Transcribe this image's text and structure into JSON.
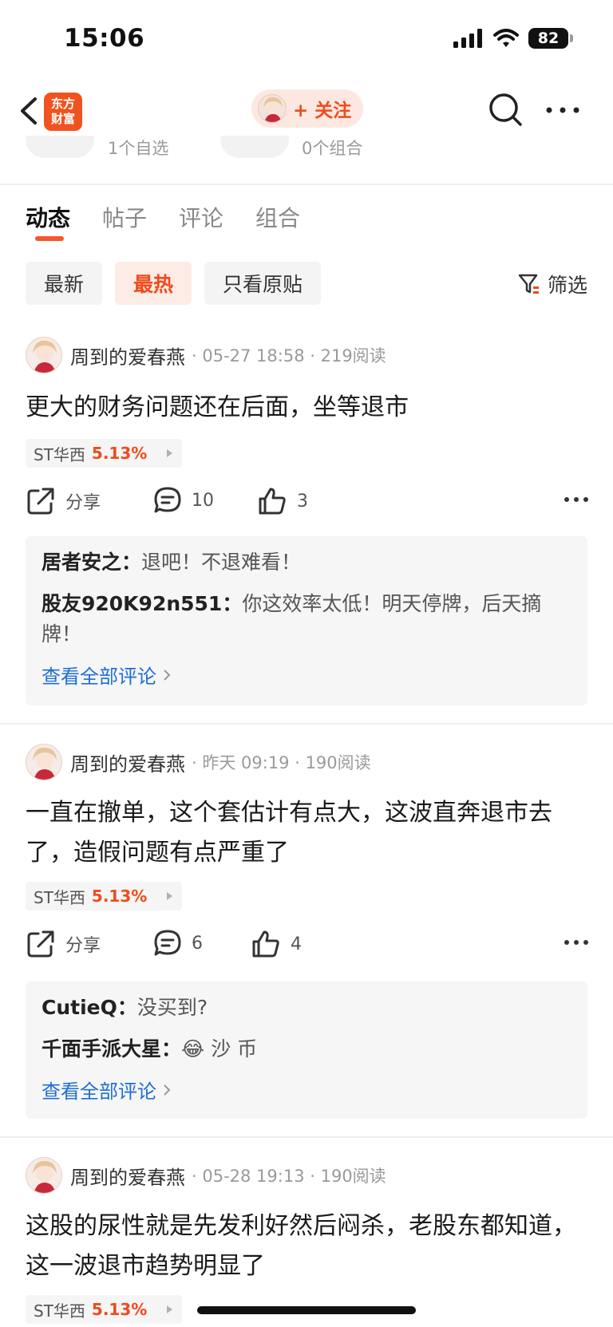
{
  "status_bar": {
    "time": "15:06",
    "battery": "82"
  },
  "nav": {
    "logo_text_line1": "东方",
    "logo_text_line2": "财富",
    "follow_label": "+ 关注"
  },
  "peek": {
    "left_text": "1个自选",
    "right_text": "0个组合"
  },
  "tabs": [
    {
      "label": "动态",
      "active": true
    },
    {
      "label": "帖子"
    },
    {
      "label": "评论"
    },
    {
      "label": "组合"
    }
  ],
  "chips": [
    {
      "label": "最新"
    },
    {
      "label": "最热",
      "active": true
    },
    {
      "label": "只看原贴"
    }
  ],
  "filter_label": "筛选",
  "posts": [
    {
      "author": "周到的爱春燕",
      "meta": "· 05-27 18:58 · 219阅读",
      "content": "更大的财务问题还在后面，坐等退市",
      "stock_name": "ST华西",
      "stock_change": "5.13%",
      "share_label": "分享",
      "comment_count": "10",
      "like_count": "3",
      "comments": [
        {
          "user": "居者安之：",
          "text": "退吧！不退难看！"
        },
        {
          "user": "股友920K92n551：",
          "text": "你这效率太低！明天停牌，后天摘牌！"
        }
      ],
      "view_all": "查看全部评论"
    },
    {
      "author": "周到的爱春燕",
      "meta": "· 昨天 09:19 · 190阅读",
      "content": "一直在撤单，这个套估计有点大，这波直奔退市去了，造假问题有点严重了",
      "stock_name": "ST华西",
      "stock_change": "5.13%",
      "share_label": "分享",
      "comment_count": "6",
      "like_count": "4",
      "comments": [
        {
          "user": "CutieQ：",
          "text": "没买到?"
        },
        {
          "user": "千面手派大星：",
          "text": "沙 币",
          "emoji": "😂"
        }
      ],
      "view_all": "查看全部评论"
    },
    {
      "author": "周到的爱春燕",
      "meta": "· 05-28 19:13 · 190阅读",
      "content": "这股的尿性就是先发利好然后闷杀，老股东都知道，这一波退市趋势明显了",
      "stock_name": "ST华西",
      "stock_change": "5.13%"
    }
  ],
  "colors": {
    "accent": "#f04a1c",
    "link": "#1e6ed8"
  }
}
